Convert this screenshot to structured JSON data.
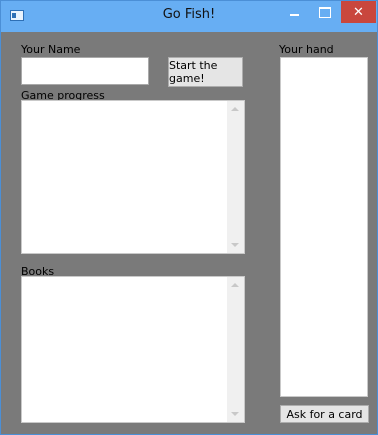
{
  "window": {
    "title": "Go Fish!"
  },
  "labels": {
    "your_name": "Your Name",
    "game_progress": "Game progress",
    "books": "Books",
    "your_hand": "Your hand"
  },
  "buttons": {
    "start_game": "Start the game!",
    "ask_card": "Ask for a card"
  },
  "inputs": {
    "name_value": "",
    "game_progress_value": "",
    "books_value": ""
  },
  "icons": {
    "app": "app-window-icon",
    "minimize": "minimize-icon",
    "maximize": "maximize-icon",
    "close": "close-icon",
    "scroll_up": "chevron-up-icon",
    "scroll_down": "chevron-down-icon"
  },
  "colors": {
    "titlebar": "#67aef3",
    "close_button": "#c9473d",
    "client_background": "#7a7a7a"
  }
}
